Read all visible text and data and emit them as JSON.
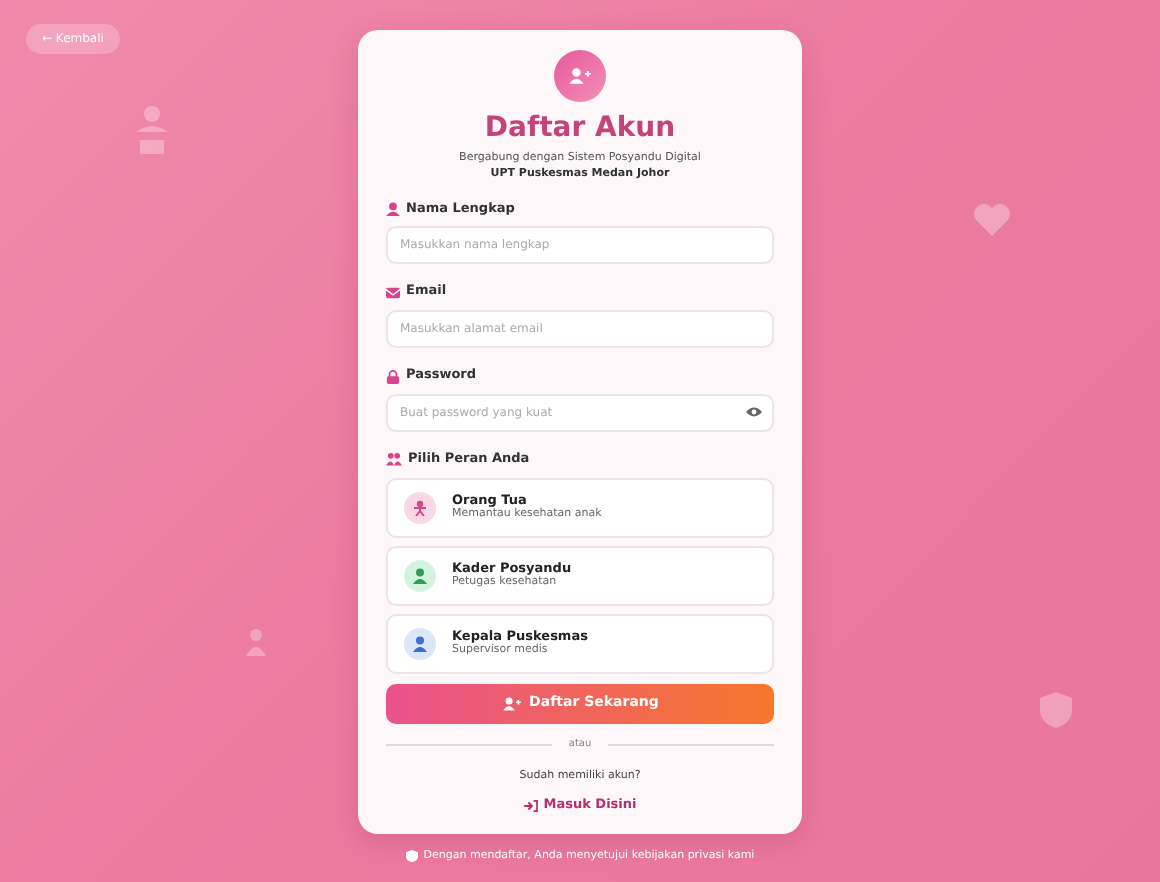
{
  "back_button": {
    "label": "← Kembali"
  },
  "card": {
    "title": "Daftar Akun",
    "subtitle": "Bergabung dengan Sistem Posyandu Digital",
    "organization": "UPT Puskesmas Medan Johor"
  },
  "fields": [
    {
      "label": "Nama Lengkap",
      "placeholder": "Masukkan nama lengkap",
      "kind": "name"
    },
    {
      "label": "Email",
      "placeholder": "Masukkan alamat email",
      "kind": "email"
    },
    {
      "label": "Password",
      "placeholder": "Buat password yang kuat",
      "kind": "password"
    }
  ],
  "roles_label": "Pilih Peran Anda",
  "roles": [
    {
      "title": "Orang Tua",
      "description": "Memantau kesehatan anak",
      "color": "#f9d7e7",
      "selected": false
    },
    {
      "title": "Kader Posyandu",
      "description": "Petugas kesehatan",
      "color": "#d4f3df",
      "selected": false
    },
    {
      "title": "Kepala Puskesmas",
      "description": "Supervisor medis",
      "color": "#dbe6fb",
      "selected": false
    }
  ],
  "submit_button": "Daftar Sekarang",
  "divider": "atau",
  "login_prompt": "Sudah memiliki akun?",
  "login_link": "Masuk Disini",
  "footer": "Dengan mendaftar, Anda menyetujui kebijakan privasi kami"
}
